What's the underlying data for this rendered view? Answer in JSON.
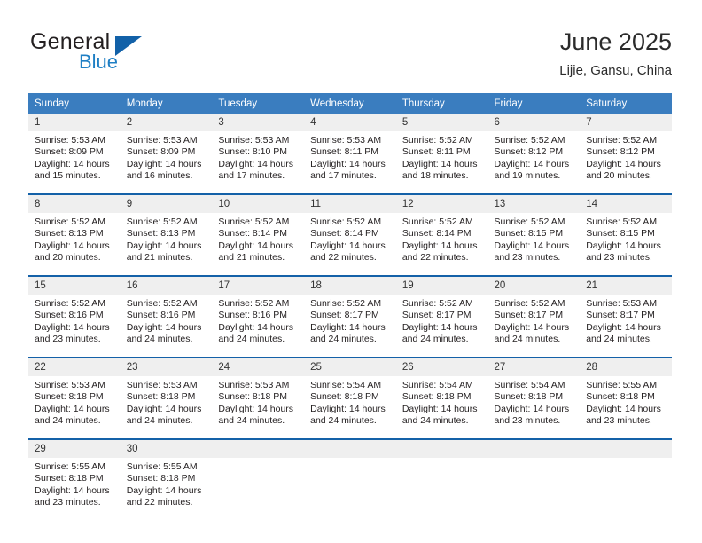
{
  "brand": {
    "name_part1": "General",
    "name_part2": "Blue",
    "triangle_color": "#1261a8",
    "blue_color": "#1f7fc4"
  },
  "header": {
    "title": "June 2025",
    "location": "Lijie, Gansu, China"
  },
  "theme": {
    "header_bg": "#3a7dbf",
    "separator": "#1461a8",
    "daynum_bg": "#efefef"
  },
  "calendar": {
    "weekday_headers": [
      "Sunday",
      "Monday",
      "Tuesday",
      "Wednesday",
      "Thursday",
      "Friday",
      "Saturday"
    ],
    "weeks": [
      [
        {
          "day": "1",
          "sunrise": "Sunrise: 5:53 AM",
          "sunset": "Sunset: 8:09 PM",
          "daylight_line1": "Daylight: 14 hours",
          "daylight_line2": "and 15 minutes."
        },
        {
          "day": "2",
          "sunrise": "Sunrise: 5:53 AM",
          "sunset": "Sunset: 8:09 PM",
          "daylight_line1": "Daylight: 14 hours",
          "daylight_line2": "and 16 minutes."
        },
        {
          "day": "3",
          "sunrise": "Sunrise: 5:53 AM",
          "sunset": "Sunset: 8:10 PM",
          "daylight_line1": "Daylight: 14 hours",
          "daylight_line2": "and 17 minutes."
        },
        {
          "day": "4",
          "sunrise": "Sunrise: 5:53 AM",
          "sunset": "Sunset: 8:11 PM",
          "daylight_line1": "Daylight: 14 hours",
          "daylight_line2": "and 17 minutes."
        },
        {
          "day": "5",
          "sunrise": "Sunrise: 5:52 AM",
          "sunset": "Sunset: 8:11 PM",
          "daylight_line1": "Daylight: 14 hours",
          "daylight_line2": "and 18 minutes."
        },
        {
          "day": "6",
          "sunrise": "Sunrise: 5:52 AM",
          "sunset": "Sunset: 8:12 PM",
          "daylight_line1": "Daylight: 14 hours",
          "daylight_line2": "and 19 minutes."
        },
        {
          "day": "7",
          "sunrise": "Sunrise: 5:52 AM",
          "sunset": "Sunset: 8:12 PM",
          "daylight_line1": "Daylight: 14 hours",
          "daylight_line2": "and 20 minutes."
        }
      ],
      [
        {
          "day": "8",
          "sunrise": "Sunrise: 5:52 AM",
          "sunset": "Sunset: 8:13 PM",
          "daylight_line1": "Daylight: 14 hours",
          "daylight_line2": "and 20 minutes."
        },
        {
          "day": "9",
          "sunrise": "Sunrise: 5:52 AM",
          "sunset": "Sunset: 8:13 PM",
          "daylight_line1": "Daylight: 14 hours",
          "daylight_line2": "and 21 minutes."
        },
        {
          "day": "10",
          "sunrise": "Sunrise: 5:52 AM",
          "sunset": "Sunset: 8:14 PM",
          "daylight_line1": "Daylight: 14 hours",
          "daylight_line2": "and 21 minutes."
        },
        {
          "day": "11",
          "sunrise": "Sunrise: 5:52 AM",
          "sunset": "Sunset: 8:14 PM",
          "daylight_line1": "Daylight: 14 hours",
          "daylight_line2": "and 22 minutes."
        },
        {
          "day": "12",
          "sunrise": "Sunrise: 5:52 AM",
          "sunset": "Sunset: 8:14 PM",
          "daylight_line1": "Daylight: 14 hours",
          "daylight_line2": "and 22 minutes."
        },
        {
          "day": "13",
          "sunrise": "Sunrise: 5:52 AM",
          "sunset": "Sunset: 8:15 PM",
          "daylight_line1": "Daylight: 14 hours",
          "daylight_line2": "and 23 minutes."
        },
        {
          "day": "14",
          "sunrise": "Sunrise: 5:52 AM",
          "sunset": "Sunset: 8:15 PM",
          "daylight_line1": "Daylight: 14 hours",
          "daylight_line2": "and 23 minutes."
        }
      ],
      [
        {
          "day": "15",
          "sunrise": "Sunrise: 5:52 AM",
          "sunset": "Sunset: 8:16 PM",
          "daylight_line1": "Daylight: 14 hours",
          "daylight_line2": "and 23 minutes."
        },
        {
          "day": "16",
          "sunrise": "Sunrise: 5:52 AM",
          "sunset": "Sunset: 8:16 PM",
          "daylight_line1": "Daylight: 14 hours",
          "daylight_line2": "and 24 minutes."
        },
        {
          "day": "17",
          "sunrise": "Sunrise: 5:52 AM",
          "sunset": "Sunset: 8:16 PM",
          "daylight_line1": "Daylight: 14 hours",
          "daylight_line2": "and 24 minutes."
        },
        {
          "day": "18",
          "sunrise": "Sunrise: 5:52 AM",
          "sunset": "Sunset: 8:17 PM",
          "daylight_line1": "Daylight: 14 hours",
          "daylight_line2": "and 24 minutes."
        },
        {
          "day": "19",
          "sunrise": "Sunrise: 5:52 AM",
          "sunset": "Sunset: 8:17 PM",
          "daylight_line1": "Daylight: 14 hours",
          "daylight_line2": "and 24 minutes."
        },
        {
          "day": "20",
          "sunrise": "Sunrise: 5:52 AM",
          "sunset": "Sunset: 8:17 PM",
          "daylight_line1": "Daylight: 14 hours",
          "daylight_line2": "and 24 minutes."
        },
        {
          "day": "21",
          "sunrise": "Sunrise: 5:53 AM",
          "sunset": "Sunset: 8:17 PM",
          "daylight_line1": "Daylight: 14 hours",
          "daylight_line2": "and 24 minutes."
        }
      ],
      [
        {
          "day": "22",
          "sunrise": "Sunrise: 5:53 AM",
          "sunset": "Sunset: 8:18 PM",
          "daylight_line1": "Daylight: 14 hours",
          "daylight_line2": "and 24 minutes."
        },
        {
          "day": "23",
          "sunrise": "Sunrise: 5:53 AM",
          "sunset": "Sunset: 8:18 PM",
          "daylight_line1": "Daylight: 14 hours",
          "daylight_line2": "and 24 minutes."
        },
        {
          "day": "24",
          "sunrise": "Sunrise: 5:53 AM",
          "sunset": "Sunset: 8:18 PM",
          "daylight_line1": "Daylight: 14 hours",
          "daylight_line2": "and 24 minutes."
        },
        {
          "day": "25",
          "sunrise": "Sunrise: 5:54 AM",
          "sunset": "Sunset: 8:18 PM",
          "daylight_line1": "Daylight: 14 hours",
          "daylight_line2": "and 24 minutes."
        },
        {
          "day": "26",
          "sunrise": "Sunrise: 5:54 AM",
          "sunset": "Sunset: 8:18 PM",
          "daylight_line1": "Daylight: 14 hours",
          "daylight_line2": "and 24 minutes."
        },
        {
          "day": "27",
          "sunrise": "Sunrise: 5:54 AM",
          "sunset": "Sunset: 8:18 PM",
          "daylight_line1": "Daylight: 14 hours",
          "daylight_line2": "and 23 minutes."
        },
        {
          "day": "28",
          "sunrise": "Sunrise: 5:55 AM",
          "sunset": "Sunset: 8:18 PM",
          "daylight_line1": "Daylight: 14 hours",
          "daylight_line2": "and 23 minutes."
        }
      ],
      [
        {
          "day": "29",
          "sunrise": "Sunrise: 5:55 AM",
          "sunset": "Sunset: 8:18 PM",
          "daylight_line1": "Daylight: 14 hours",
          "daylight_line2": "and 23 minutes."
        },
        {
          "day": "30",
          "sunrise": "Sunrise: 5:55 AM",
          "sunset": "Sunset: 8:18 PM",
          "daylight_line1": "Daylight: 14 hours",
          "daylight_line2": "and 22 minutes."
        },
        {
          "day": "",
          "sunrise": "",
          "sunset": "",
          "daylight_line1": "",
          "daylight_line2": ""
        },
        {
          "day": "",
          "sunrise": "",
          "sunset": "",
          "daylight_line1": "",
          "daylight_line2": ""
        },
        {
          "day": "",
          "sunrise": "",
          "sunset": "",
          "daylight_line1": "",
          "daylight_line2": ""
        },
        {
          "day": "",
          "sunrise": "",
          "sunset": "",
          "daylight_line1": "",
          "daylight_line2": ""
        },
        {
          "day": "",
          "sunrise": "",
          "sunset": "",
          "daylight_line1": "",
          "daylight_line2": ""
        }
      ]
    ]
  }
}
